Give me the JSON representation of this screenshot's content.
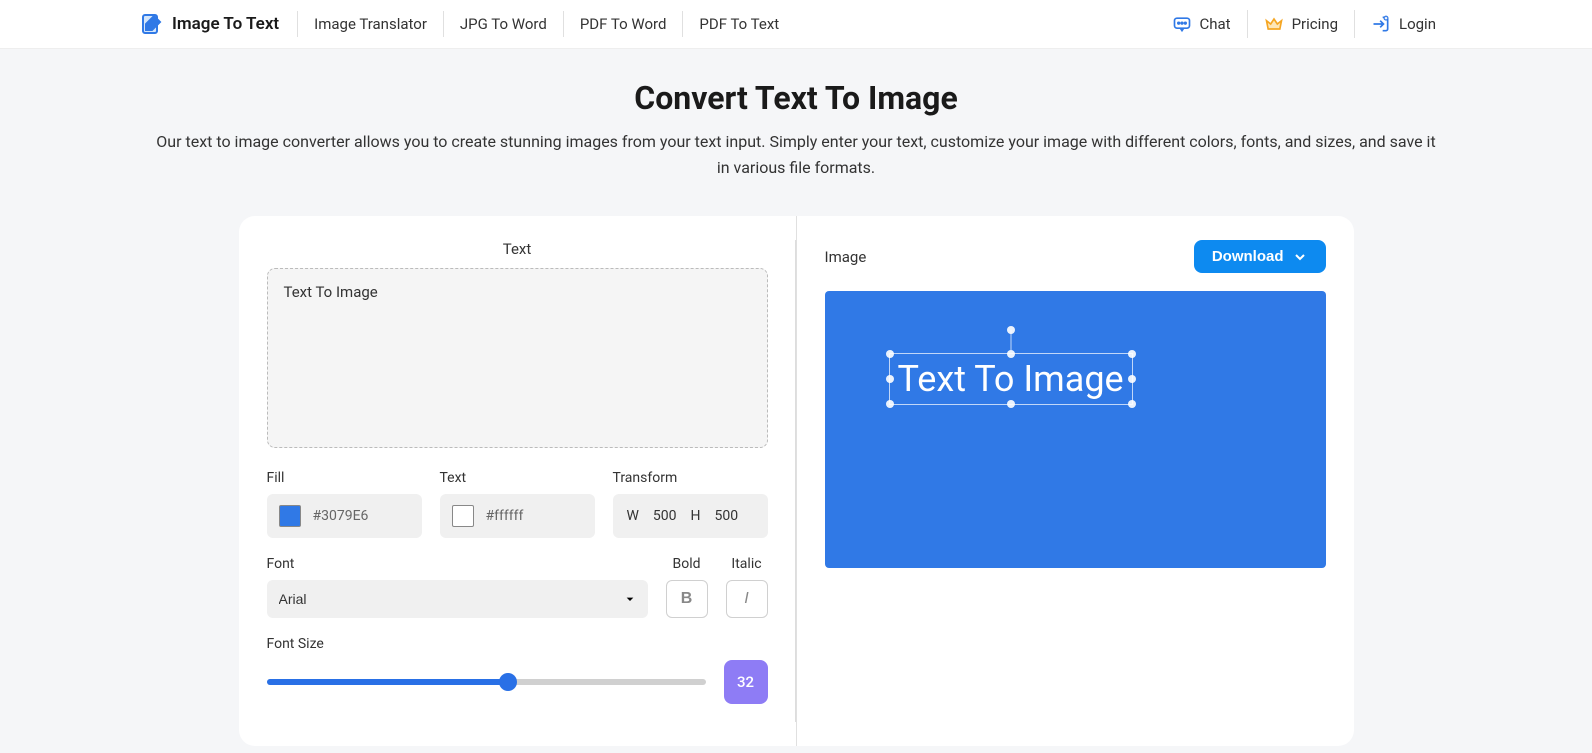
{
  "header": {
    "logo": "Image To Text",
    "nav": [
      "Image Translator",
      "JPG To Word",
      "PDF To Word",
      "PDF To Text"
    ],
    "actions": {
      "chat": "Chat",
      "pricing": "Pricing",
      "login": "Login"
    }
  },
  "hero": {
    "title": "Convert Text To Image",
    "desc": "Our text to image converter allows you to create stunning images from your text input. Simply enter your text, customize your image with different colors, fonts, and sizes, and save it in various file formats."
  },
  "editor": {
    "text_section_label": "Text",
    "image_section_label": "Image",
    "download_label": "Download",
    "text_value": "Text To Image",
    "fill": {
      "label": "Fill",
      "color": "#3079E6",
      "display": "#3079E6"
    },
    "text_color": {
      "label": "Text",
      "color": "#ffffff",
      "display": "#ffffff"
    },
    "transform": {
      "label": "Transform",
      "w_label": "W",
      "w_value": "500",
      "h_label": "H",
      "h_value": "500"
    },
    "font": {
      "label": "Font",
      "selected": "Arial"
    },
    "bold_label": "Bold",
    "italic_label": "Italic",
    "fontsize_label": "Font Size",
    "fontsize_value": "32",
    "canvas_text": "Text To Image"
  }
}
